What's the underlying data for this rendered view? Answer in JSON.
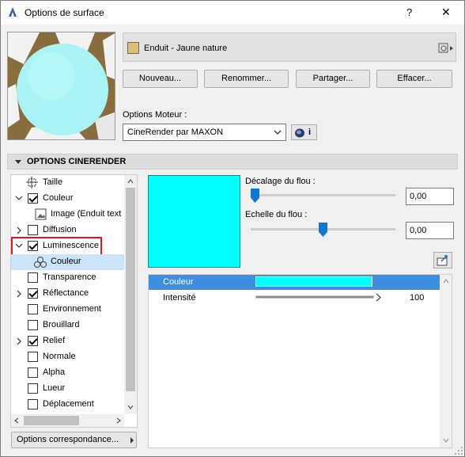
{
  "window": {
    "title": "Options de surface",
    "help": "?",
    "close": "✕"
  },
  "surface": {
    "name": "Enduit - Jaune nature",
    "swatch_color": "#d9c07a"
  },
  "buttons": {
    "new": "Nouveau...",
    "rename": "Renommer...",
    "share": "Partager...",
    "delete": "Effacer..."
  },
  "engine": {
    "label": "Options Moteur :",
    "selected": "CineRender par MAXON",
    "info": "i"
  },
  "section": {
    "title": "OPTIONS CINERENDER"
  },
  "tree": {
    "items": [
      {
        "label": "Taille"
      },
      {
        "label": "Couleur"
      },
      {
        "label": "Image (Enduit text"
      },
      {
        "label": "Diffusion"
      },
      {
        "label": "Luminescence"
      },
      {
        "label": "Couleur"
      },
      {
        "label": "Transparence"
      },
      {
        "label": "Réflectance"
      },
      {
        "label": "Environnement"
      },
      {
        "label": "Brouillard"
      },
      {
        "label": "Relief"
      },
      {
        "label": "Normale"
      },
      {
        "label": "Alpha"
      },
      {
        "label": "Lueur"
      },
      {
        "label": "Déplacement"
      }
    ]
  },
  "match_button": "Options correspondance...",
  "preview_color": "#00ffff",
  "blur_offset": {
    "label": "Décalage du flou :",
    "value": "0,00",
    "slider": 0.0
  },
  "blur_scale": {
    "label": "Echelle du flou :",
    "value": "0,00",
    "slider": 0.5
  },
  "props": {
    "color": {
      "label": "Couleur",
      "swatch": "#00ffff"
    },
    "intensity": {
      "label": "Intensité",
      "value": "100",
      "fill": 1.0
    }
  }
}
